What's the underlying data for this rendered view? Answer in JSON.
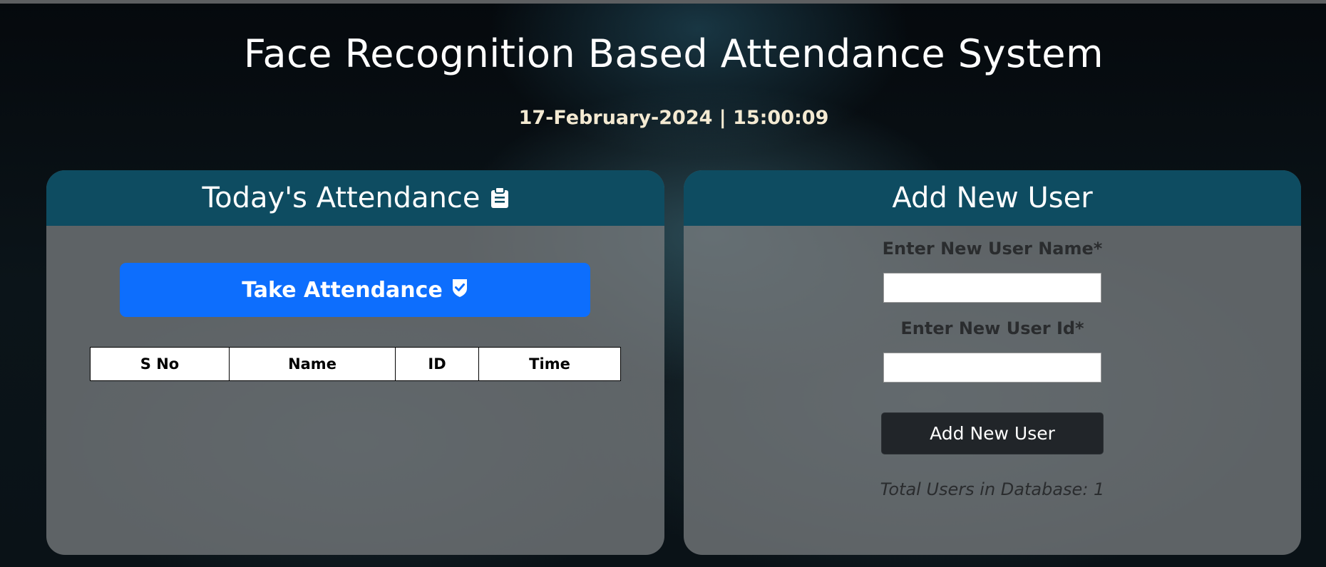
{
  "header": {
    "title": "Face Recognition Based Attendance System",
    "datetime": "17-February-2024 | 15:00:09"
  },
  "attendance_panel": {
    "title": "Today's Attendance",
    "title_icon": "clipboard-icon",
    "take_button_label": "Take Attendance",
    "take_button_icon": "shield-check-icon",
    "table": {
      "columns": [
        "S No",
        "Name",
        "ID",
        "Time"
      ],
      "rows": []
    }
  },
  "add_user_panel": {
    "title": "Add New User",
    "name_label": "Enter New User Name*",
    "name_value": "",
    "id_label": "Enter New User Id*",
    "id_value": "",
    "submit_label": "Add New User",
    "total_users_text": "Total Users in Database: 1"
  },
  "colors": {
    "panel_header": "#0e4c61",
    "primary_button": "#0d6efd",
    "dark_button": "#212529"
  }
}
